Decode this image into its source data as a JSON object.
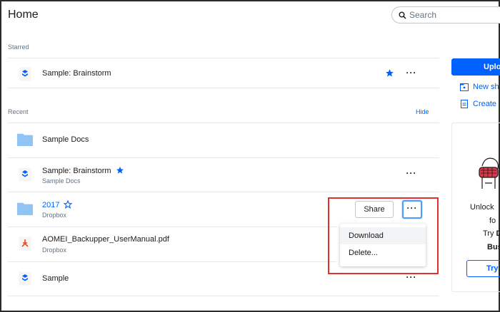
{
  "header": {
    "title": "Home"
  },
  "search": {
    "placeholder": "Search"
  },
  "starred": {
    "label": "Starred",
    "items": [
      {
        "name": "Sample: Brainstorm"
      }
    ]
  },
  "recent": {
    "label": "Recent",
    "hide_label": "Hide",
    "items": [
      {
        "name": "Sample Docs",
        "location": ""
      },
      {
        "name": "Sample: Brainstorm",
        "location": "Sample Docs"
      },
      {
        "name": "2017",
        "location": "Dropbox"
      },
      {
        "name": "AOMEI_Backupper_UserManual.pdf",
        "location": "Dropbox"
      },
      {
        "name": "Sample",
        "location": ""
      }
    ]
  },
  "actions": {
    "share_label": "Share",
    "more_label": "···"
  },
  "menu": {
    "items": [
      "Download",
      "Delete..."
    ]
  },
  "sidebar": {
    "upload_label": "Uplo",
    "new_shared_label": "New sh",
    "create_label": "Create",
    "promo": {
      "line1": "Unlock",
      "line2": "fo",
      "line3_prefix": "Try",
      "line3_bold": "D",
      "line4": "Bus",
      "try_label": "Try"
    }
  },
  "colors": {
    "accent": "#0061fe",
    "highlight_box": "#e02f2f",
    "folder": "#8fc4f5"
  }
}
